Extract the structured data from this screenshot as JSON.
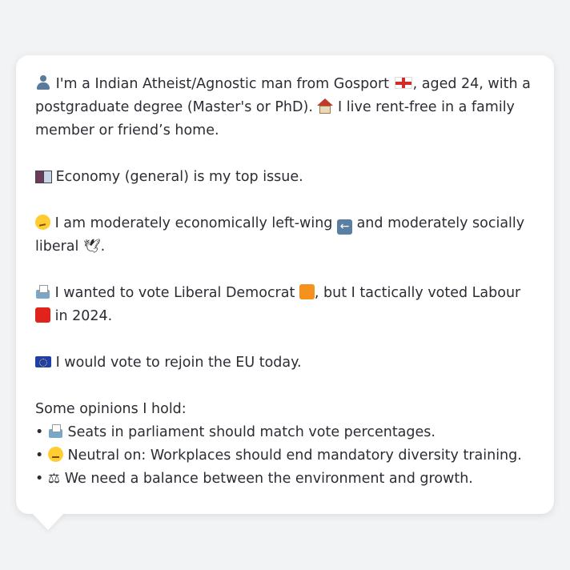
{
  "message": {
    "intro": {
      "icon": "person-icon",
      "text_1": "I'm a Indian Atheist/Agnostic man from Gosport",
      "flag_icon": "england-flag-icon",
      "text_2": ", aged 24, with a postgraduate degree (Master's or PhD).",
      "house_icon": "house-icon",
      "text_3": "I live rent-free in a family member or friend’s home."
    },
    "top_issue": {
      "icon": "book-icon",
      "text": "Economy (general) is my top issue."
    },
    "ideology": {
      "icon": "thinking-face-icon",
      "text_1": "I am moderately economically left-wing",
      "arrow_icon": "left-arrow-icon",
      "text_2": "and moderately socially liberal",
      "dove_icon": "dove-icon",
      "text_3": "."
    },
    "vote": {
      "icon": "ballot-box-icon",
      "text_1": "I wanted to vote Liberal Democrat",
      "party1_color": "#f5921e",
      "text_2": ", but I tactically voted Labour",
      "party2_color": "#e0241b",
      "text_3": "in 2024."
    },
    "eu": {
      "icon": "eu-flag-icon",
      "text": "I would vote to rejoin the EU today."
    },
    "opinions": {
      "heading": "Some opinions I hold:",
      "items": [
        {
          "bullet": "•",
          "icon": "ballot-box-icon",
          "text": "Seats in parliament should match vote percentages."
        },
        {
          "bullet": "•",
          "icon": "neutral-face-icon",
          "text": "Neutral on: Workplaces should end mandatory diversity training."
        },
        {
          "bullet": "•",
          "icon": "balance-scale-icon",
          "text": "We need a balance between the environment and growth."
        }
      ]
    }
  }
}
